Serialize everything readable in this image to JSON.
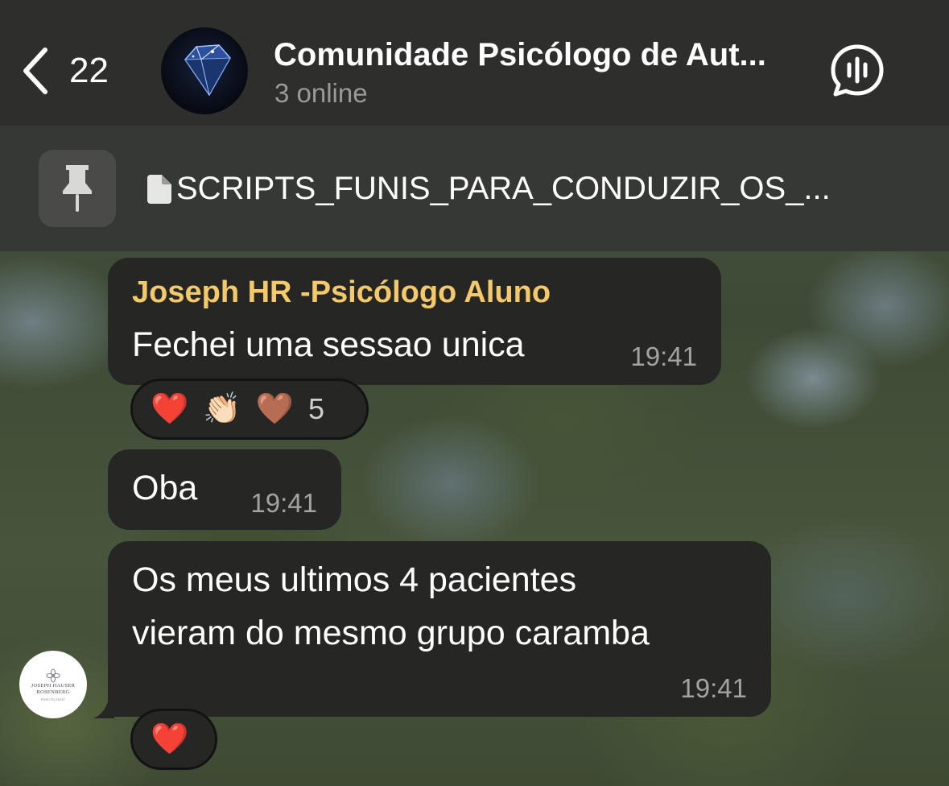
{
  "header": {
    "back_count": "22",
    "title": "Comunidade Psicólogo de Aut...",
    "subtitle": "3 online"
  },
  "pinned": {
    "text": "SCRIPTS_FUNIS_PARA_CONDUZIR_OS_..."
  },
  "messages": [
    {
      "sender": "Joseph HR -Psicólogo Aluno",
      "text": "Fechei uma sessao unica",
      "time": "19:41",
      "reactions": [
        "❤️",
        "👏🏻",
        "🤎"
      ],
      "reaction_count": "5"
    },
    {
      "text": "Oba",
      "time": "19:41"
    },
    {
      "lines": [
        "Os meus ultimos 4 pacientes",
        "vieram do mesmo grupo caramba"
      ],
      "time": "19:41",
      "reactions": [
        "❤️"
      ]
    }
  ],
  "user_avatar": {
    "name_line1": "JOSEPH HAUSER",
    "name_line2": "ROSENBERG",
    "subtitle": "PSICÓLOGO"
  },
  "colors": {
    "sender_name": "#f4c96a",
    "bubble": "#262725",
    "header_bg": "#2e2f2d",
    "pinned_bg": "#363835"
  }
}
